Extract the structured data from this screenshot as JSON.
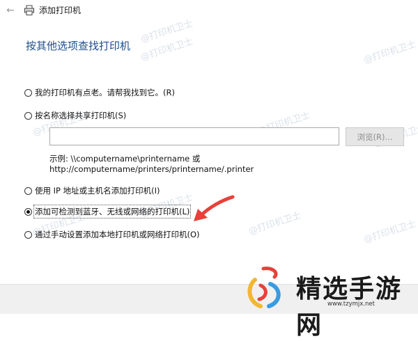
{
  "window": {
    "title": "添加打印机"
  },
  "heading": "按其他选项查找打印机",
  "options": [
    {
      "label": "我的打印机有点老。请帮我找到它。(R)",
      "checked": false
    },
    {
      "label": "按名称选择共享打印机(S)",
      "checked": false
    },
    {
      "label": "使用 IP 地址或主机名添加打印机(I)",
      "checked": false
    },
    {
      "label": "添加可检测到蓝牙、无线或网络的打印机(L)",
      "checked": true
    },
    {
      "label": "通过手动设置添加本地打印机或网络打印机(O)",
      "checked": false
    }
  ],
  "shared_printer": {
    "input_value": "",
    "browse_label": "浏览(R)...",
    "example_line1": "示例: \\\\computername\\printername 或",
    "example_line2": "http://computername/printers/printername/.printer"
  },
  "watermark": "@打印机卫士",
  "logo": {
    "name": "精选手游网",
    "url": "www.tzymjx.net"
  },
  "colors": {
    "heading": "#1e4e8c",
    "arrow": "#e8403a",
    "footer": "#f0f0f0"
  }
}
